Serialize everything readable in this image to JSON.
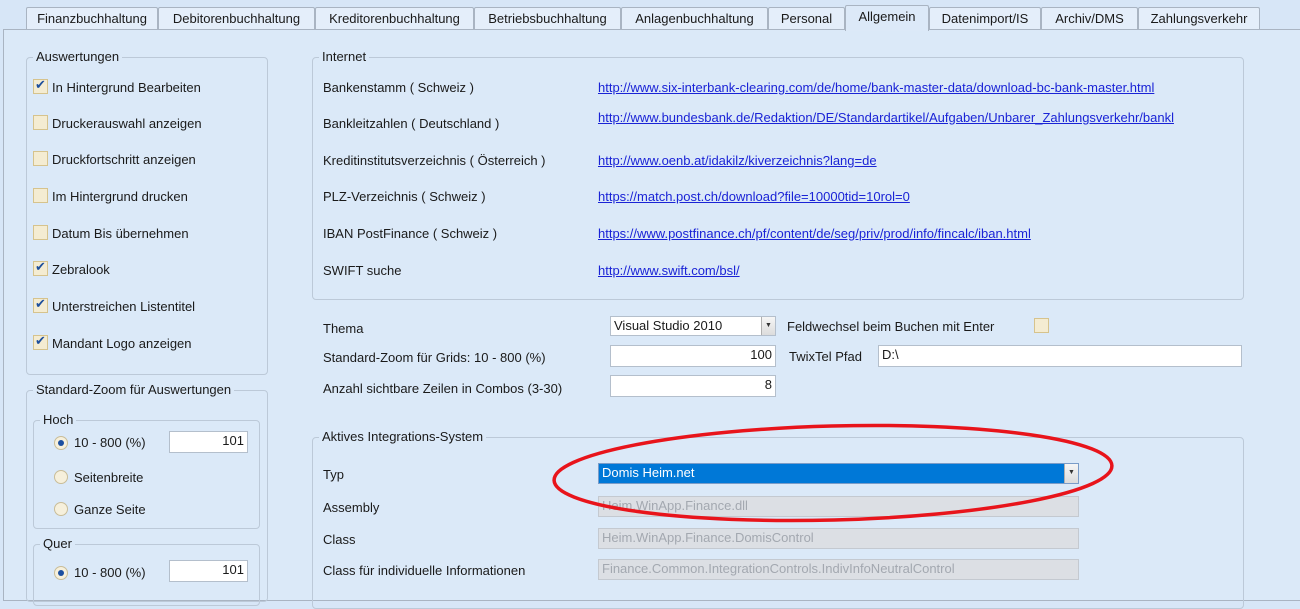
{
  "tabs": [
    "Finanzbuchhaltung",
    "Debitorenbuchhaltung",
    "Kreditorenbuchhaltung",
    "Betriebsbuchhaltung",
    "Anlagenbuchhaltung",
    "Personal",
    "Allgemein",
    "Datenimport/IS",
    "Archiv/DMS",
    "Zahlungsverkehr"
  ],
  "active_tab": "Allgemein",
  "auswertungen": {
    "title": "Auswertungen",
    "items": [
      {
        "label": "In Hintergrund Bearbeiten",
        "checked": true
      },
      {
        "label": "Druckerauswahl anzeigen",
        "checked": false
      },
      {
        "label": "Druckfortschritt anzeigen",
        "checked": false
      },
      {
        "label": "Im Hintergrund drucken",
        "checked": false
      },
      {
        "label": "Datum Bis übernehmen",
        "checked": false
      },
      {
        "label": "Zebralook",
        "checked": true
      },
      {
        "label": "Unterstreichen Listentitel",
        "checked": true
      },
      {
        "label": "Mandant Logo anzeigen",
        "checked": true
      }
    ]
  },
  "zoom": {
    "title": "Standard-Zoom für Auswertungen",
    "hoch": {
      "title": "Hoch",
      "options": [
        "10 - 800 (%)",
        "Seitenbreite",
        "Ganze Seite"
      ],
      "selected": 0,
      "value": "101"
    },
    "quer": {
      "title": "Quer",
      "options": [
        "10 - 800 (%)"
      ],
      "selected": 0,
      "value": "101"
    }
  },
  "internet": {
    "title": "Internet",
    "rows": [
      {
        "label": "Bankenstamm ( Schweiz )",
        "url": "http://www.six-interbank-clearing.com/de/home/bank-master-data/download-bc-bank-master.html"
      },
      {
        "label": "Bankleitzahlen ( Deutschland )",
        "url": "http://www.bundesbank.de/Redaktion/DE/Standardartikel/Aufgaben/Unbarer_Zahlungsverkehr/bankl"
      },
      {
        "label": "Kreditinstitutsverzeichnis  ( Österreich )",
        "url": "http://www.oenb.at/idakilz/kiverzeichnis?lang=de"
      },
      {
        "label": "PLZ-Verzeichnis ( Schweiz )",
        "url": "https://match.post.ch/download?file=10000tid=10rol=0"
      },
      {
        "label": "IBAN PostFinance ( Schweiz )",
        "url": "https://www.postfinance.ch/pf/content/de/seg/priv/prod/info/fincalc/iban.html"
      },
      {
        "label": "SWIFT suche",
        "url": "http://www.swift.com/bsl/"
      }
    ]
  },
  "settings": {
    "thema_label": "Thema",
    "thema_value": "Visual Studio 2010",
    "feldwechsel_label": "Feldwechsel beim Buchen mit Enter",
    "feldwechsel_checked": false,
    "grid_zoom_label": "Standard-Zoom für Grids: 10 - 800 (%)",
    "grid_zoom_value": "100",
    "twixtel_label": "TwixTel Pfad",
    "twixtel_value": "D:\\",
    "combo_rows_label": "Anzahl sichtbare Zeilen in Combos (3-30)",
    "combo_rows_value": "8"
  },
  "integration": {
    "title": "Aktives Integrations-System",
    "typ_label": "Typ",
    "typ_value": "Domis Heim.net",
    "assembly_label": "Assembly",
    "assembly_value": "Heim.WinApp.Finance.dll",
    "class_label": "Class",
    "class_value": "Heim.WinApp.Finance.DomisControl",
    "indiv_label": "Class für individuelle Informationen",
    "indiv_value": "Finance.Common.IntegrationControls.IndivInfoNeutralControl"
  },
  "colors": {
    "highlight": "#0078d7",
    "annotation": "#e8141b"
  }
}
